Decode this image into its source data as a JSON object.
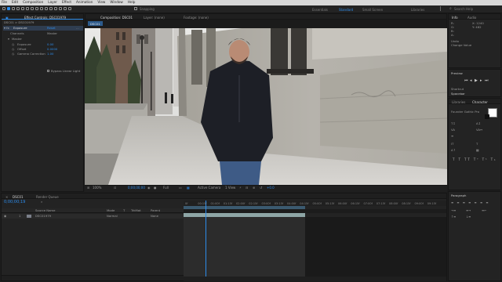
{
  "menu": [
    "File",
    "Edit",
    "Composition",
    "Layer",
    "Effect",
    "Animation",
    "View",
    "Window",
    "Help"
  ],
  "toolbar": {
    "snapping_label": "Snapping",
    "workspaces": [
      "Essentials",
      "Standard",
      "Small Screen",
      "Libraries"
    ],
    "active_workspace": "Standard",
    "search_placeholder": "Search Help"
  },
  "effect_controls": {
    "tab_label": "Effect Controls: DSC01979",
    "layer_path": "DSC01 > DSC01979",
    "effect_name": "Exposure",
    "reset_label": "Reset",
    "channels_label": "Channels",
    "channels_value": "Master",
    "rows": [
      {
        "label": "Master",
        "value": ""
      },
      {
        "label": "Exposure",
        "value": "0.00"
      },
      {
        "label": "Offset",
        "value": "0.0000"
      },
      {
        "label": "Gamma Correction",
        "value": "1.00"
      }
    ],
    "bypass_label": "Bypass Linear Light"
  },
  "viewer": {
    "tabs": [
      "Composition: DSC01",
      "Layer: (none)",
      "Footage: (none)"
    ],
    "comp_tab_label": "DSC01",
    "zoom": "100%",
    "timecode": "0;00;00;00",
    "resolution": "Full",
    "camera": "Active Camera",
    "views": "1 View",
    "exposure": "+0.0"
  },
  "right_panels": {
    "info_tab": "Info",
    "audio_tab": "Audio",
    "info_lines": [
      "R:",
      "G:",
      "B:",
      "A:",
      "X: 1240",
      "Y: 482"
    ],
    "undo_label": "Undo",
    "undo_value": "Change Value",
    "preview_label": "Preview",
    "shortcut_label": "Shortcut",
    "shortcut_value": "Spacebar",
    "libraries_tab": "Libraries",
    "character_tab": "Character",
    "font_value": "Founder Gothic Pro",
    "paragraph_label": "Paragraph"
  },
  "timeline": {
    "comp_tab": "DSC01",
    "render_queue_tab": "Render Queue",
    "timecode": "0;00;00;19",
    "columns": [
      "Source Name",
      "Mode",
      "T",
      "TrkMat",
      "Parent"
    ],
    "layer": {
      "number": "1",
      "name": "DSC01979",
      "mode": "Normal",
      "parent": "None"
    },
    "ticks": [
      "0f",
      "00:15f",
      "01:00f",
      "01:15f",
      "02:00f",
      "02:15f",
      "03:00f",
      "03:15f",
      "04:00f",
      "04:15f",
      "05:00f",
      "05:15f",
      "06:00f",
      "06:15f",
      "07:00f",
      "07:15f",
      "08:00f",
      "08:15f",
      "09:00f",
      "09:15f"
    ]
  },
  "colors": {
    "accent": "#2d8ceb",
    "panel_bg": "#232323",
    "layer_bar": "#8ea6a6",
    "work_area": "#3b5a70"
  }
}
